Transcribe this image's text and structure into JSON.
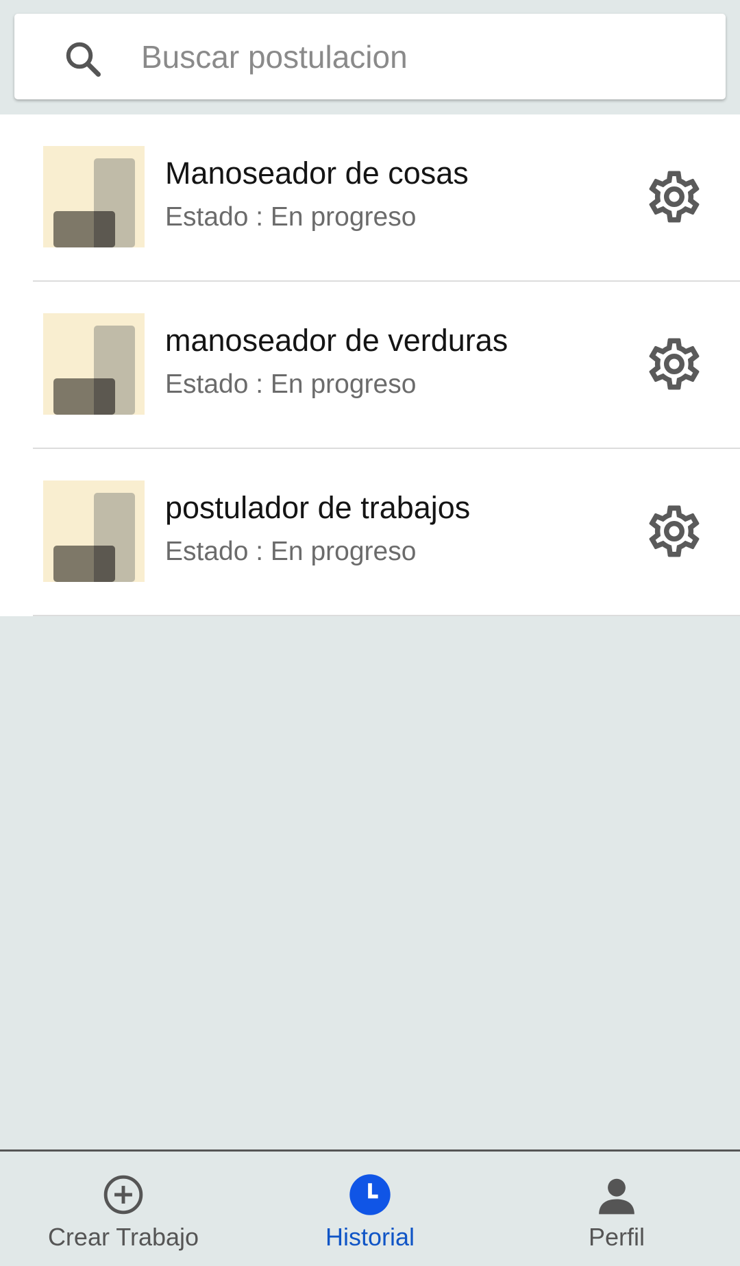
{
  "search": {
    "placeholder": "Buscar postulacion",
    "value": "",
    "icon": "search-icon"
  },
  "jobs": [
    {
      "title": "Manoseador de cosas",
      "status": "Estado : En progreso"
    },
    {
      "title": "manoseador de verduras",
      "status": "Estado : En progreso"
    },
    {
      "title": "postulador de trabajos",
      "status": "Estado : En progreso"
    }
  ],
  "nav": {
    "items": [
      {
        "label": "Crear Trabajo",
        "icon": "add-circle-icon",
        "active": false
      },
      {
        "label": "Historial",
        "icon": "clock-icon",
        "active": true
      },
      {
        "label": "Perfil",
        "icon": "person-icon",
        "active": false
      }
    ]
  },
  "colors": {
    "background": "#e1e8e8",
    "active": "#1055c6",
    "text": "#141414",
    "secondary_text": "#6b6b6b",
    "thumb_bg": "#f9eed0"
  }
}
